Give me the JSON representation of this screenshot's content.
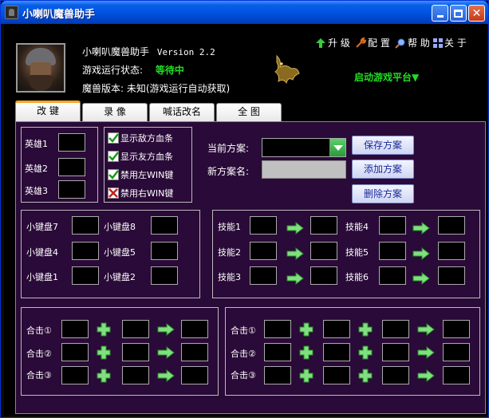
{
  "window": {
    "title": "小喇叭魔兽助手"
  },
  "header": {
    "app_name": "小喇叭魔兽助手",
    "version": "Version 2.2",
    "status_label": "游戏运行状态:",
    "status_value": "等待中",
    "wc_version_label": "魔兽版本:",
    "wc_version_value": "未知(游戏运行自动获取)"
  },
  "menu": {
    "upgrade": "升 级",
    "config": "配 置",
    "help": "帮 助",
    "about": "关 于",
    "launch": "启动游戏平台▼"
  },
  "tabs": [
    {
      "label": "改 键"
    },
    {
      "label": "录 像"
    },
    {
      "label": "喊话改名"
    },
    {
      "label": "全 图"
    }
  ],
  "heroes": {
    "labels": [
      "英雄1",
      "英雄2",
      "英雄3"
    ]
  },
  "checkboxes": [
    {
      "label": "显示敌方血条",
      "state": "checked"
    },
    {
      "label": "显示友方血条",
      "state": "checked"
    },
    {
      "label": "禁用左WIN键",
      "state": "checked"
    },
    {
      "label": "禁用右WIN键",
      "state": "crossed"
    }
  ],
  "scheme": {
    "current_label": "当前方案:",
    "new_label": "新方案名:",
    "save_btn": "保存方案",
    "add_btn": "添加方案",
    "delete_btn": "删除方案"
  },
  "keypad": {
    "labels": [
      "小键盘7",
      "小键盘8",
      "小键盘4",
      "小键盘5",
      "小键盘1",
      "小键盘2"
    ]
  },
  "skills": {
    "labels": [
      "技能1",
      "技能4",
      "技能2",
      "技能5",
      "技能3",
      "技能6"
    ]
  },
  "combos_left": {
    "labels": [
      "合击①",
      "合击②",
      "合击③"
    ]
  },
  "combos_right": {
    "labels": [
      "合击①",
      "合击②",
      "合击③"
    ]
  },
  "colors": {
    "accent_green": "#22dd22",
    "panel_bg": "#2a0a38",
    "titlebar_blue": "#0054e3",
    "active_tab_top": "#f5a623"
  }
}
